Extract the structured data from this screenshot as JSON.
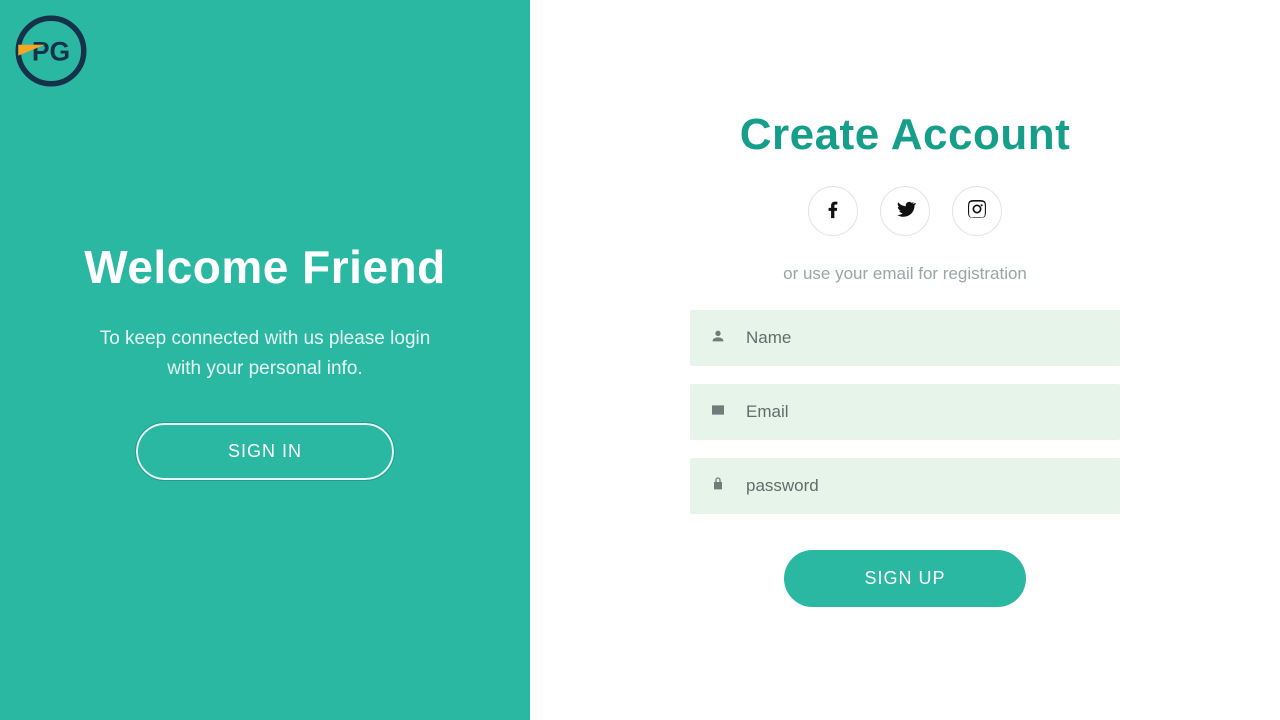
{
  "left": {
    "title": "Welcome Friend",
    "subtitle": "To keep connected with us please login with your personal info.",
    "signin_label": "SIGN IN"
  },
  "right": {
    "title": "Create Account",
    "hint": "or use your email for registration",
    "name_placeholder": "Name",
    "email_placeholder": "Email",
    "password_placeholder": "password",
    "signup_label": "SIGN UP"
  },
  "colors": {
    "accent": "#2bb8a3",
    "heading": "#159e89",
    "field_bg": "#e7f4ea"
  }
}
